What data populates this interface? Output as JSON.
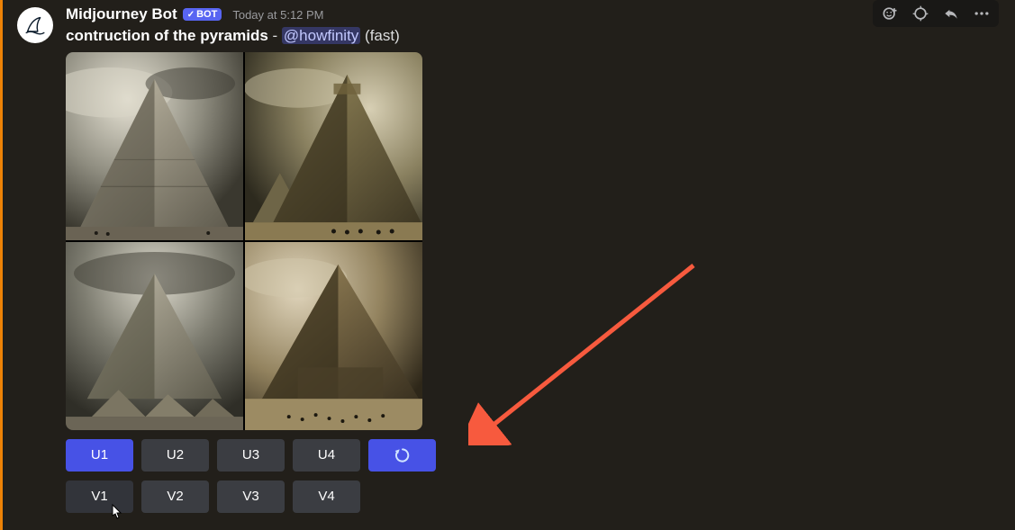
{
  "message": {
    "author": "Midjourney Bot",
    "bot_tag": "BOT",
    "timestamp": "Today at 5:12 PM",
    "prompt": "contruction of the pyramids",
    "separator": " - ",
    "mention": "@howfinity",
    "suffix": " (fast)"
  },
  "buttons": {
    "row1": [
      {
        "label": "U1",
        "style": "primary"
      },
      {
        "label": "U2",
        "style": "secondary"
      },
      {
        "label": "U3",
        "style": "secondary"
      },
      {
        "label": "U4",
        "style": "secondary"
      },
      {
        "icon": "refresh",
        "style": "primary"
      }
    ],
    "row2": [
      {
        "label": "V1",
        "style": "hover"
      },
      {
        "label": "V2",
        "style": "secondary"
      },
      {
        "label": "V3",
        "style": "secondary"
      },
      {
        "label": "V4",
        "style": "secondary"
      }
    ]
  },
  "hover_actions": [
    "add-reaction",
    "super-reaction",
    "reply",
    "more"
  ],
  "colors": {
    "accent": "#5865f2",
    "arrow": "#f75a3e"
  }
}
